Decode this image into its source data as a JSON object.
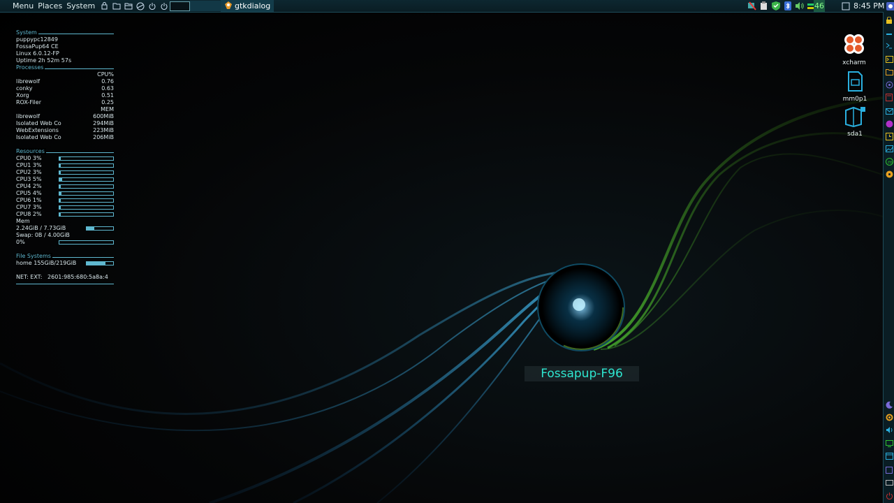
{
  "taskbar": {
    "menus": [
      "Menu",
      "Places",
      "System"
    ],
    "task_title": "gtkdialog",
    "cpu_percent": "46",
    "clock": "8:45 PM"
  },
  "conky": {
    "system": {
      "header": "System",
      "hostname": "puppypc12849",
      "distro": "FossaPup64 CE",
      "kernel": "Linux 6.0.12-FP",
      "uptime": "Uptime 2h 52m 57s"
    },
    "processes": {
      "header": "Processes",
      "cpu_label": "CPU%",
      "cpu_list": [
        {
          "name": "librewolf",
          "value": "0.76"
        },
        {
          "name": "conky",
          "value": "0.63"
        },
        {
          "name": "Xorg",
          "value": "0.51"
        },
        {
          "name": "ROX-Filer",
          "value": "0.25"
        }
      ],
      "mem_label": "MEM",
      "mem_list": [
        {
          "name": "librewolf",
          "value": "600MiB"
        },
        {
          "name": "Isolated Web Co",
          "value": "294MiB"
        },
        {
          "name": "WebExtensions",
          "value": "223MiB"
        },
        {
          "name": "Isolated Web Co",
          "value": "206MiB"
        }
      ]
    },
    "resources": {
      "header": "Resources",
      "cpus": [
        {
          "label": "CPU0 3%",
          "percent": 3
        },
        {
          "label": "CPU1 3%",
          "percent": 3
        },
        {
          "label": "CPU2 3%",
          "percent": 3
        },
        {
          "label": "CPU3 5%",
          "percent": 5
        },
        {
          "label": "CPU4 2%",
          "percent": 2
        },
        {
          "label": "CPU5 4%",
          "percent": 4
        },
        {
          "label": "CPU6 1%",
          "percent": 1
        },
        {
          "label": "CPU7 3%",
          "percent": 3
        },
        {
          "label": "CPU8 2%",
          "percent": 2
        }
      ],
      "mem_label": "Mem",
      "mem_value": "2.24GiB / 7.73GiB",
      "mem_percent": 29,
      "swap_value": "Swap: 0B  / 4.00GiB",
      "swap_pct_label": "0%",
      "swap_percent": 0
    },
    "filesystems": {
      "header": "File Systems",
      "home": "home 155GiB/219GiB",
      "home_percent": 71
    },
    "net": {
      "label": "NET: EXT:",
      "address": "2601:985:680:5a8a:4"
    }
  },
  "desktop_icons": [
    {
      "label": "xcharm",
      "icon": "xcharm-icon"
    },
    {
      "label": "mm0p1",
      "icon": "sd-card-icon"
    },
    {
      "label": "sda1",
      "icon": "drive-icon"
    }
  ],
  "caption": "Fossapup-F96",
  "colors": {
    "accent": "#5fb8d0",
    "caption_text": "#2ee6d0",
    "panel_bg": "#0a1d24"
  }
}
